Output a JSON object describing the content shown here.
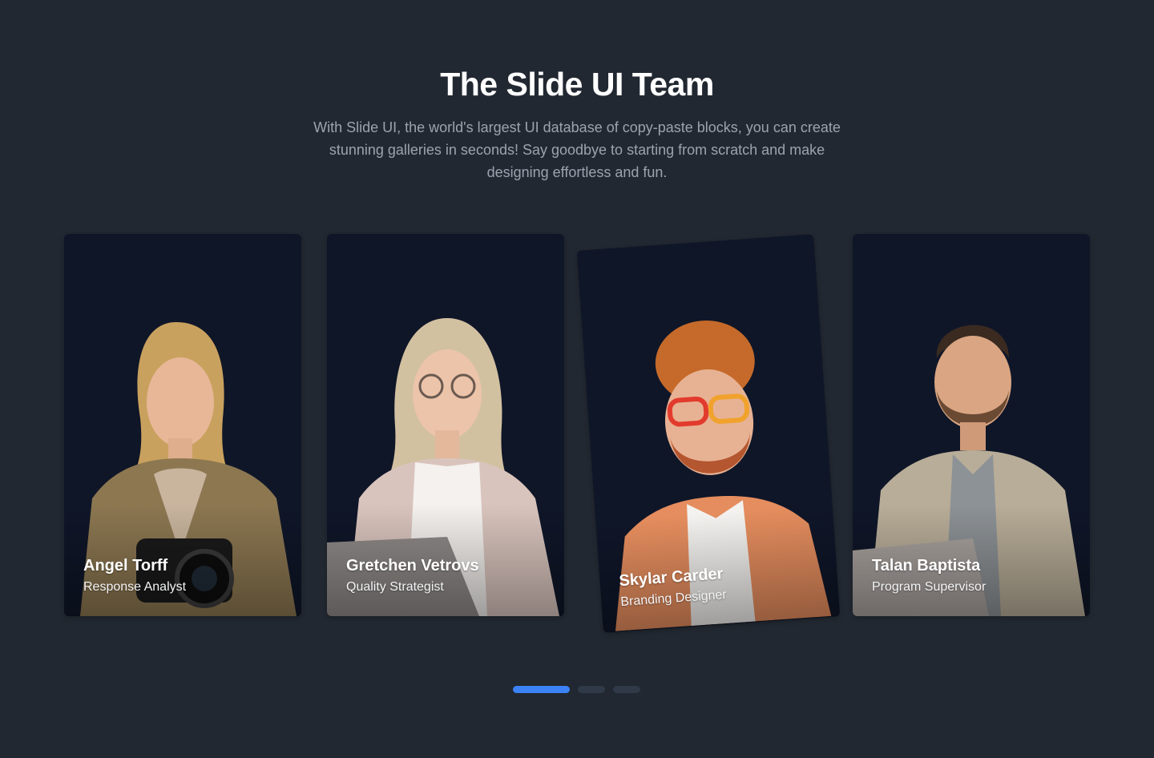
{
  "header": {
    "title": "The Slide UI Team",
    "subtitle": "With Slide UI, the world's largest UI database of copy-paste blocks, you can create stunning galleries in seconds! Say goodbye to starting from scratch and make designing effortless and fun."
  },
  "team": [
    {
      "name": "Angel Torff",
      "role": "Response Analyst"
    },
    {
      "name": "Gretchen Vetrovs",
      "role": "Quality Strategist"
    },
    {
      "name": "Skylar Carder",
      "role": "Branding Designer"
    },
    {
      "name": "Talan Baptista",
      "role": "Program Supervisor"
    }
  ],
  "pagination": {
    "active_index": 0,
    "count": 3
  },
  "colors": {
    "background": "#222831",
    "card": "#0f1628",
    "accent": "#3b82f6"
  }
}
